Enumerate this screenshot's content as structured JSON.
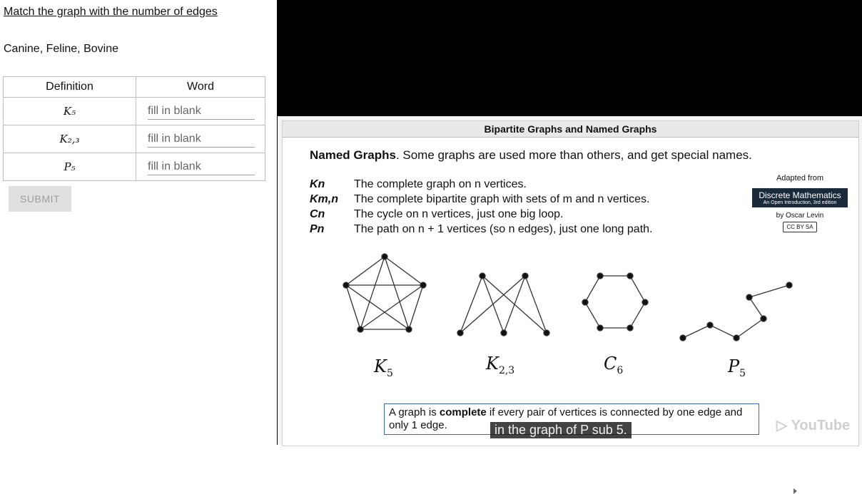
{
  "question": {
    "title": "Match the graph with the number of edges",
    "words": "Canine, Feline, Bovine",
    "table_headers": [
      "Definition",
      "Word"
    ],
    "rows": [
      {
        "definition": "K₅",
        "placeholder": "fill in blank"
      },
      {
        "definition": "K₂,₃",
        "placeholder": "fill in blank"
      },
      {
        "definition": "P₅",
        "placeholder": "fill in blank"
      }
    ],
    "submit_label": "SUBMIT"
  },
  "video": {
    "slide_title": "Bipartite Graphs and Named Graphs",
    "intro_bold": "Named Graphs",
    "intro_rest": ".  Some graphs are used more than others, and get special names.",
    "definitions": [
      {
        "symbol": "Kn",
        "text": "The complete graph on n vertices."
      },
      {
        "symbol": "Km,n",
        "text": "The complete bipartite graph with sets of m and n vertices."
      },
      {
        "symbol": "Cn",
        "text": "The cycle on n vertices, just one big loop."
      },
      {
        "symbol": "Pn",
        "text": "The path on n + 1 vertices (so n edges), just one long path."
      }
    ],
    "adapted_from": "Adapted from",
    "book_title": "Discrete Mathematics",
    "book_subtitle": "An Open Introduction, 3rd edition",
    "author": "by Oscar Levin",
    "license": "CC BY SA",
    "graph_labels": [
      "K5",
      "K2,3",
      "C6",
      "P5"
    ],
    "caption_pre": "A graph is ",
    "caption_bold": "complete",
    "caption_post": " if every pair of vertices is connected by one edge and only 1 edge.",
    "subtitle": "in the graph of P sub 5.",
    "brand": "YouTube"
  }
}
